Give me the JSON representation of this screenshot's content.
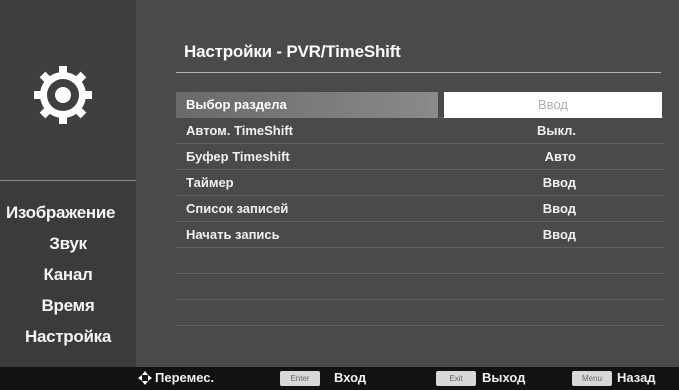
{
  "sidebar": {
    "items": [
      {
        "label": "Изображение"
      },
      {
        "label": "Звук"
      },
      {
        "label": "Канал"
      },
      {
        "label": "Время"
      },
      {
        "label": "Настройка"
      }
    ]
  },
  "panel": {
    "title": "Настройки - PVR/TimeShift",
    "rows": [
      {
        "label": "Выбор раздела",
        "value": "Ввод"
      },
      {
        "label": "Автом. TimeShift",
        "value": "Выкл."
      },
      {
        "label": "Буфер Timeshift",
        "value": "Авто"
      },
      {
        "label": "Таймер",
        "value": "Ввод"
      },
      {
        "label": "Список записей",
        "value": "Ввод"
      },
      {
        "label": "Начать запись",
        "value": "Ввод"
      }
    ]
  },
  "footer": {
    "move_label": "Перемес.",
    "enter_key": "Enter",
    "enter_label": "Вход",
    "exit_key": "Exit",
    "exit_label": "Выход",
    "menu_key": "Menu",
    "menu_label": "Назад"
  }
}
